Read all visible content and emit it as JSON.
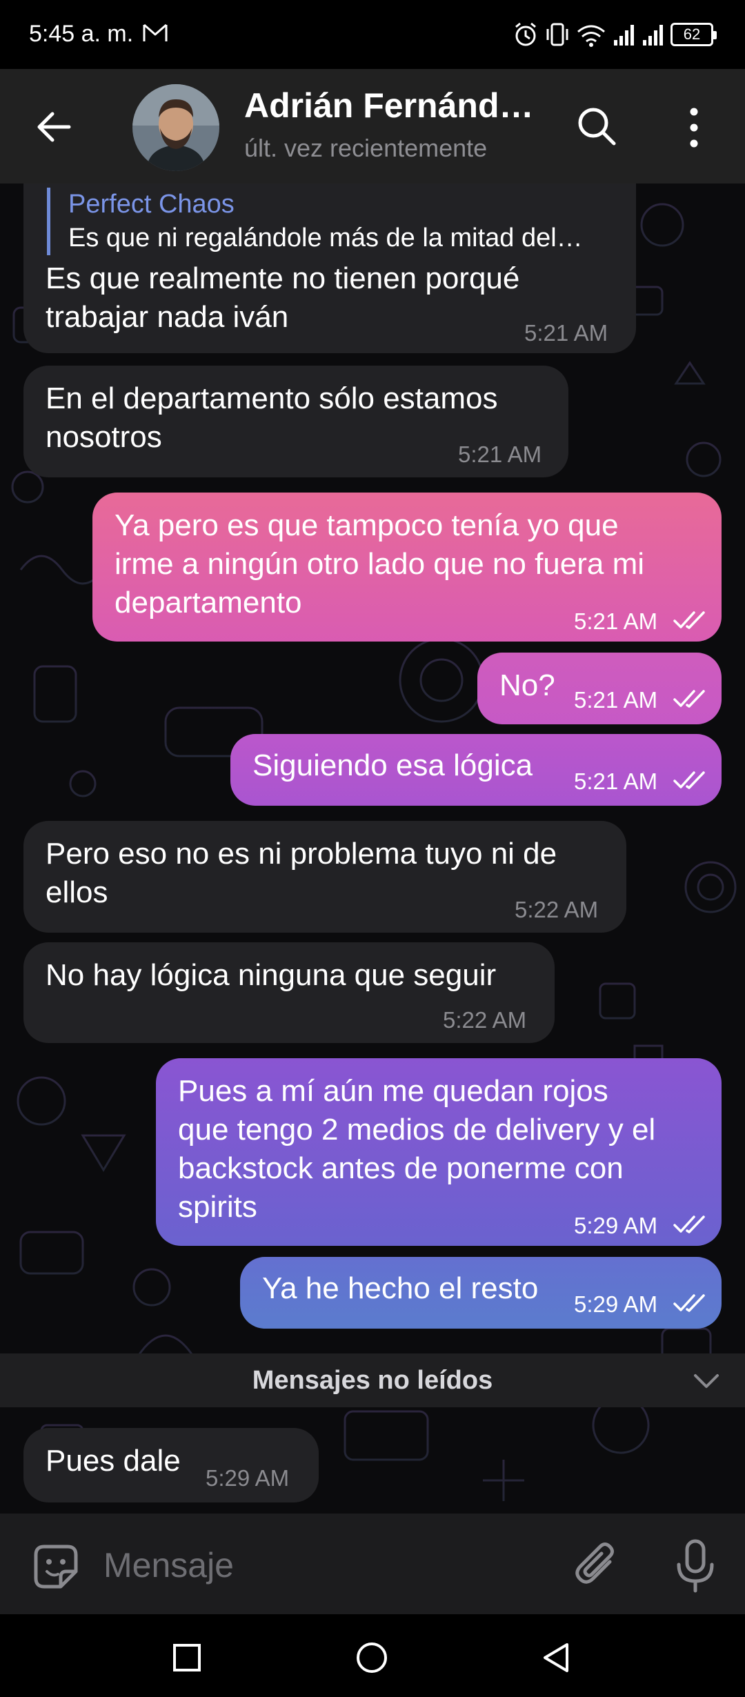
{
  "status_bar": {
    "time": "5:45 a. m.",
    "battery": "62"
  },
  "header": {
    "contact_name": "Adrián Fernánd…",
    "contact_status": "últ. vez recientemente"
  },
  "messages": [
    {
      "direction": "in",
      "reply_to": {
        "name": "Perfect Chaos",
        "text": "Es que ni regalándole más de la mitad del…"
      },
      "lines": [
        "Es que realmente no tienen porqué",
        "trabajar nada iván"
      ],
      "time": "5:21 AM"
    },
    {
      "direction": "in",
      "lines": [
        "En el departamento sólo estamos",
        "nosotros"
      ],
      "time": "5:21 AM"
    },
    {
      "direction": "out",
      "lines": [
        "Ya pero es que tampoco tenía yo que",
        "irme a ningún otro lado que no fuera mi",
        "departamento"
      ],
      "time": "5:21 AM",
      "read": true
    },
    {
      "direction": "out",
      "lines": [
        "No?"
      ],
      "time": "5:21 AM",
      "read": true
    },
    {
      "direction": "out",
      "lines": [
        "Siguiendo esa lógica"
      ],
      "time": "5:21 AM",
      "read": true
    },
    {
      "direction": "in",
      "lines": [
        "Pero eso no es ni problema tuyo ni de",
        "ellos"
      ],
      "time": "5:22 AM"
    },
    {
      "direction": "in",
      "lines": [
        "No hay lógica ninguna que seguir"
      ],
      "time": "5:22 AM"
    },
    {
      "direction": "out",
      "lines": [
        "Pues a mí aún me quedan rojos",
        "que tengo 2 medios de delivery y el",
        "backstock antes de ponerme con",
        "spirits"
      ],
      "time": "5:29 AM",
      "read": true
    },
    {
      "direction": "out",
      "lines": [
        "Ya he hecho el resto"
      ],
      "time": "5:29 AM",
      "read": true
    },
    {
      "direction": "in",
      "lines": [
        "Pues dale"
      ],
      "time": "5:29 AM"
    }
  ],
  "unread_label": "Mensajes no leídos",
  "composer": {
    "placeholder": "Mensaje"
  },
  "colors": {
    "header_bg": "#212121",
    "incoming_bubble": "#222225",
    "outgoing_gradient_top": "#e4609a",
    "outgoing_gradient_mid": "#b955c8",
    "outgoing_gradient_bottom": "#5b7ad0",
    "accent_reply": "#7b95e8"
  }
}
